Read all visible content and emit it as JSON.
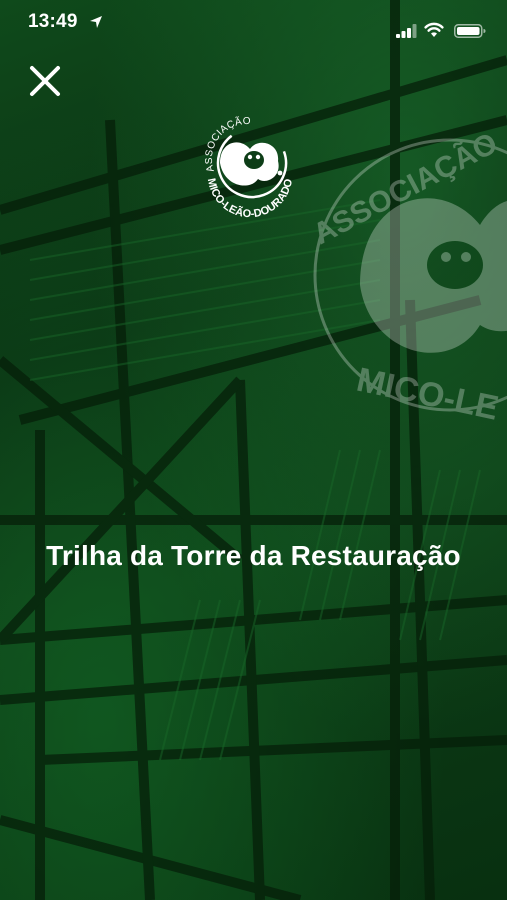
{
  "status_bar": {
    "time": "13:49",
    "icons": [
      "location-arrow-icon",
      "signal-icon",
      "wifi-icon",
      "battery-icon"
    ]
  },
  "header": {
    "close_icon": "close-icon"
  },
  "logo": {
    "line1": "ASSOCIAÇÃO",
    "line2": "MICO-LEÃO-DOURADO"
  },
  "watermark": {
    "line1": "ASSOCIAÇÃO",
    "line2": "MICO-LE"
  },
  "main": {
    "title": "Trilha da Torre da Restauração"
  },
  "colors": {
    "overlay_green": "#0d3d17",
    "text": "#ffffff"
  }
}
